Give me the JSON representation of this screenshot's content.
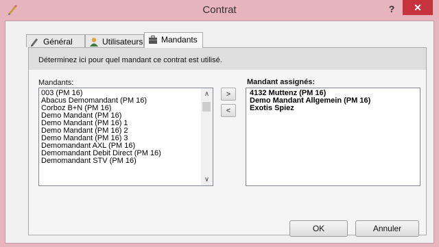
{
  "window": {
    "title": "Contrat",
    "help_label": "?",
    "close_label": "✕"
  },
  "tabs": [
    {
      "label": "Général",
      "icon": "pencil-icon",
      "active": false
    },
    {
      "label": "Utilisateurs",
      "icon": "user-icon",
      "active": false
    },
    {
      "label": "Mandants",
      "icon": "briefcase-icon",
      "active": true
    }
  ],
  "panel": {
    "description": "Déterminez ici pour quel mandant ce contrat est utilisé.",
    "available_label": "Mandants:",
    "assigned_label": "Mandant assignés:",
    "available_items": [
      "003 (PM 16)",
      "Abacus Demomandant (PM 16)",
      "Corboz B+N (PM 16)",
      "Demo Mandant (PM 16)",
      "Demo Mandant (PM 16) 1",
      "Demo Mandant (PM 16) 2",
      "Demo Mandant (PM 16) 3",
      "Demomandant AXL (PM 16)",
      "Demomandant Debit Direct (PM 16)",
      "Demomandant STV (PM 16)"
    ],
    "assigned_items": [
      "4132 Muttenz (PM 16)",
      "Demo Mandant Allgemein (PM 16)",
      "Exotis Spiez"
    ],
    "add_label": ">",
    "remove_label": "<"
  },
  "footer": {
    "ok_label": "OK",
    "cancel_label": "Annuler"
  }
}
